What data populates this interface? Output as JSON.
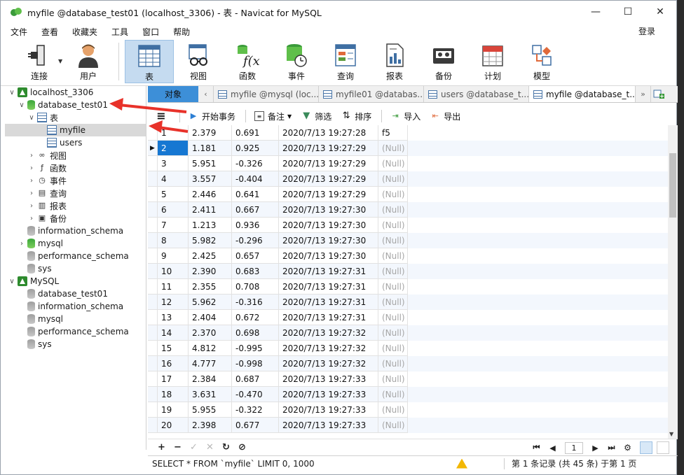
{
  "window": {
    "title": "myfile @database_test01 (localhost_3306) - 表 - Navicat for MySQL",
    "minimize": "—",
    "maximize": "☐",
    "close": "✕"
  },
  "menu": {
    "items": [
      "文件",
      "查看",
      "收藏夹",
      "工具",
      "窗口",
      "帮助"
    ],
    "login": "登录"
  },
  "toolbar": {
    "items": [
      {
        "label": "连接",
        "icon": "connection-plug-icon"
      },
      {
        "label": "用户",
        "icon": "user-icon"
      },
      {
        "label": "表",
        "icon": "table-icon"
      },
      {
        "label": "视图",
        "icon": "view-glasses-icon"
      },
      {
        "label": "函数",
        "icon": "function-icon"
      },
      {
        "label": "事件",
        "icon": "event-clock-icon"
      },
      {
        "label": "查询",
        "icon": "query-icon"
      },
      {
        "label": "报表",
        "icon": "report-icon"
      },
      {
        "label": "备份",
        "icon": "backup-tape-icon"
      },
      {
        "label": "计划",
        "icon": "calendar-icon"
      },
      {
        "label": "模型",
        "icon": "model-icon"
      }
    ]
  },
  "tree": {
    "rows": [
      {
        "label": "localhost_3306",
        "level": 0,
        "chev": "∨",
        "icon": "conn"
      },
      {
        "label": "database_test01",
        "level": 1,
        "chev": "∨",
        "icon": "db-green"
      },
      {
        "label": "表",
        "level": 2,
        "chev": "∨",
        "icon": "table"
      },
      {
        "label": "myfile",
        "level": 3,
        "chev": "",
        "icon": "table",
        "selected": true
      },
      {
        "label": "users",
        "level": 3,
        "chev": "",
        "icon": "table"
      },
      {
        "label": "视图",
        "level": 2,
        "chev": "›",
        "icon": "glasses"
      },
      {
        "label": "函数",
        "level": 2,
        "chev": "›",
        "icon": "fx"
      },
      {
        "label": "事件",
        "level": 2,
        "chev": "›",
        "icon": "clock"
      },
      {
        "label": "查询",
        "level": 2,
        "chev": "›",
        "icon": "query"
      },
      {
        "label": "报表",
        "level": 2,
        "chev": "›",
        "icon": "report"
      },
      {
        "label": "备份",
        "level": 2,
        "chev": "›",
        "icon": "backup"
      },
      {
        "label": "information_schema",
        "level": 1,
        "chev": "",
        "icon": "db"
      },
      {
        "label": "mysql",
        "level": 1,
        "chev": "›",
        "icon": "db-green"
      },
      {
        "label": "performance_schema",
        "level": 1,
        "chev": "",
        "icon": "db"
      },
      {
        "label": "sys",
        "level": 1,
        "chev": "",
        "icon": "db"
      },
      {
        "label": "MySQL",
        "level": 0,
        "chev": "∨",
        "icon": "conn"
      },
      {
        "label": "database_test01",
        "level": 1,
        "chev": "",
        "icon": "db"
      },
      {
        "label": "information_schema",
        "level": 1,
        "chev": "",
        "icon": "db"
      },
      {
        "label": "mysql",
        "level": 1,
        "chev": "",
        "icon": "db"
      },
      {
        "label": "performance_schema",
        "level": 1,
        "chev": "",
        "icon": "db"
      },
      {
        "label": "sys",
        "level": 1,
        "chev": "",
        "icon": "db"
      }
    ]
  },
  "tabs": {
    "object": "对象",
    "prev": "‹",
    "next": "»",
    "items": [
      {
        "label": "myfile @mysql (loc...",
        "active": false
      },
      {
        "label": "myfile01 @databas...",
        "active": false
      },
      {
        "label": "users @database_t...",
        "active": false
      },
      {
        "label": "myfile @database_t...",
        "active": true
      }
    ]
  },
  "gridbar": {
    "menu_icon": "≡",
    "begin_transaction": "开始事务",
    "note": "备注",
    "filter": "筛选",
    "sort": "排序",
    "import": "导入",
    "export": "导出"
  },
  "grid": {
    "header_fragment": "f5",
    "rows": [
      {
        "id": "1",
        "f2": "2.379",
        "f3": "0.691",
        "f4": "2020/7/13 19:27:28",
        "f5": "f5",
        "f5null": false
      },
      {
        "id": "2",
        "f2": "1.181",
        "f3": "0.925",
        "f4": "2020/7/13 19:27:29",
        "f5": "(Null)",
        "f5null": true,
        "current": true
      },
      {
        "id": "3",
        "f2": "5.951",
        "f3": "-0.326",
        "f4": "2020/7/13 19:27:29",
        "f5": "(Null)",
        "f5null": true
      },
      {
        "id": "4",
        "f2": "3.557",
        "f3": "-0.404",
        "f4": "2020/7/13 19:27:29",
        "f5": "(Null)",
        "f5null": true
      },
      {
        "id": "5",
        "f2": "2.446",
        "f3": "0.641",
        "f4": "2020/7/13 19:27:29",
        "f5": "(Null)",
        "f5null": true
      },
      {
        "id": "6",
        "f2": "2.411",
        "f3": "0.667",
        "f4": "2020/7/13 19:27:30",
        "f5": "(Null)",
        "f5null": true
      },
      {
        "id": "7",
        "f2": "1.213",
        "f3": "0.936",
        "f4": "2020/7/13 19:27:30",
        "f5": "(Null)",
        "f5null": true
      },
      {
        "id": "8",
        "f2": "5.982",
        "f3": "-0.296",
        "f4": "2020/7/13 19:27:30",
        "f5": "(Null)",
        "f5null": true
      },
      {
        "id": "9",
        "f2": "2.425",
        "f3": "0.657",
        "f4": "2020/7/13 19:27:30",
        "f5": "(Null)",
        "f5null": true
      },
      {
        "id": "10",
        "f2": "2.390",
        "f3": "0.683",
        "f4": "2020/7/13 19:27:31",
        "f5": "(Null)",
        "f5null": true
      },
      {
        "id": "11",
        "f2": "2.355",
        "f3": "0.708",
        "f4": "2020/7/13 19:27:31",
        "f5": "(Null)",
        "f5null": true
      },
      {
        "id": "12",
        "f2": "5.962",
        "f3": "-0.316",
        "f4": "2020/7/13 19:27:31",
        "f5": "(Null)",
        "f5null": true
      },
      {
        "id": "13",
        "f2": "2.404",
        "f3": "0.672",
        "f4": "2020/7/13 19:27:31",
        "f5": "(Null)",
        "f5null": true
      },
      {
        "id": "14",
        "f2": "2.370",
        "f3": "0.698",
        "f4": "2020/7/13 19:27:32",
        "f5": "(Null)",
        "f5null": true
      },
      {
        "id": "15",
        "f2": "4.812",
        "f3": "-0.995",
        "f4": "2020/7/13 19:27:32",
        "f5": "(Null)",
        "f5null": true
      },
      {
        "id": "16",
        "f2": "4.777",
        "f3": "-0.998",
        "f4": "2020/7/13 19:27:32",
        "f5": "(Null)",
        "f5null": true
      },
      {
        "id": "17",
        "f2": "2.384",
        "f3": "0.687",
        "f4": "2020/7/13 19:27:33",
        "f5": "(Null)",
        "f5null": true
      },
      {
        "id": "18",
        "f2": "3.631",
        "f3": "-0.470",
        "f4": "2020/7/13 19:27:33",
        "f5": "(Null)",
        "f5null": true
      },
      {
        "id": "19",
        "f2": "5.955",
        "f3": "-0.322",
        "f4": "2020/7/13 19:27:33",
        "f5": "(Null)",
        "f5null": true
      },
      {
        "id": "20",
        "f2": "2.398",
        "f3": "0.677",
        "f4": "2020/7/13 19:27:33",
        "f5": "(Null)",
        "f5null": true
      }
    ]
  },
  "navbar": {
    "add": "+",
    "delete": "−",
    "apply": "✓",
    "cancel": "✕",
    "refresh": "↻",
    "stop": "⊘",
    "first": "⏮",
    "prev": "◀",
    "page": "1",
    "next": "▶",
    "last": "⏭",
    "settings": "⚙"
  },
  "status": {
    "sql": "SELECT * FROM `myfile` LIMIT 0, 1000",
    "record_info": "第 1 条记录 (共 45 条) 于第 1 页"
  },
  "colors": {
    "accent": "#3d8fd8",
    "selected_cell": "#1677d2",
    "annotation_arrow": "#e8322a"
  }
}
